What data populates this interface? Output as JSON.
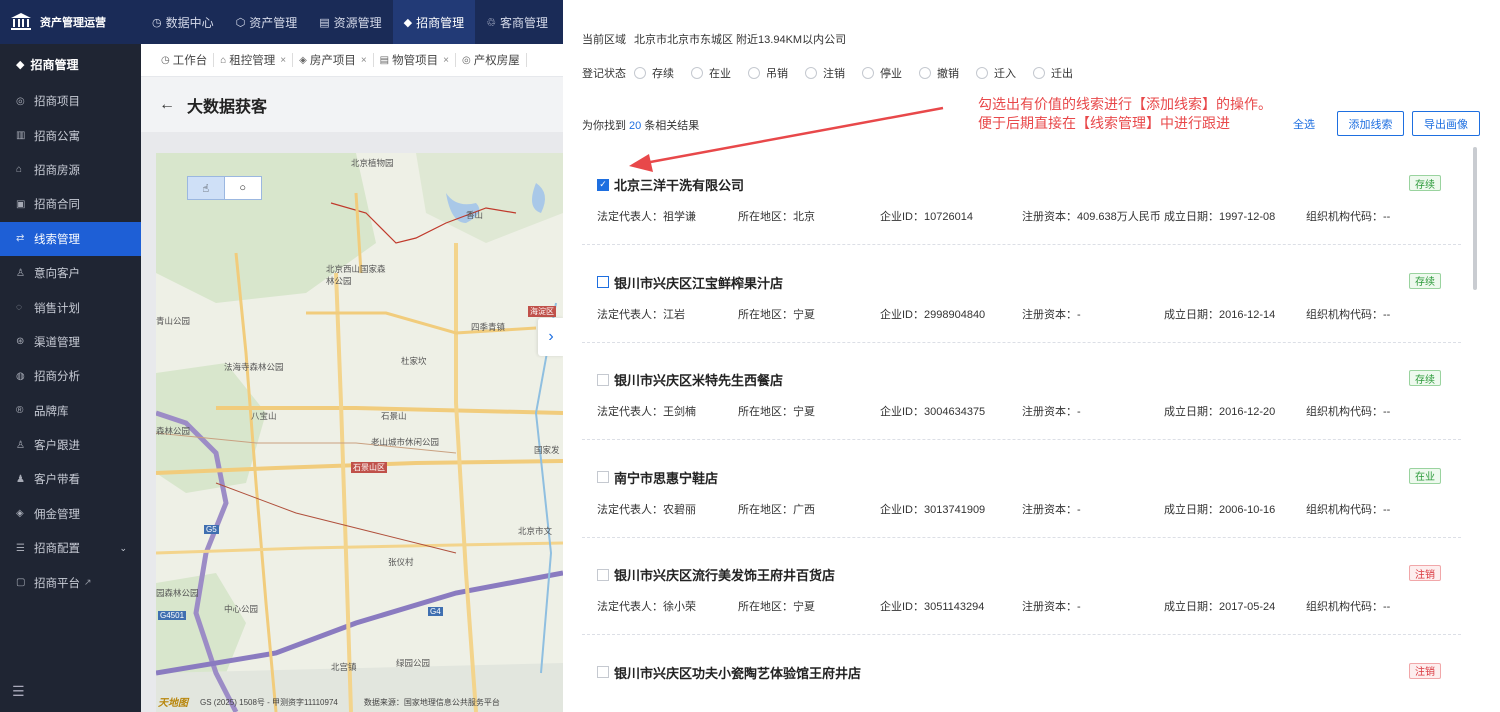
{
  "app": {
    "title": "资产管理运营"
  },
  "topnav": [
    {
      "icon": "◷",
      "label": "数据中心"
    },
    {
      "icon": "⬡",
      "label": "资产管理"
    },
    {
      "icon": "▤",
      "label": "资源管理"
    },
    {
      "icon": "◆",
      "label": "招商管理"
    },
    {
      "icon": "♲",
      "label": "客商管理"
    }
  ],
  "sidebar": {
    "section": "招商管理",
    "items": [
      {
        "icon": "◎",
        "label": "招商项目"
      },
      {
        "icon": "▥",
        "label": "招商公寓"
      },
      {
        "icon": "⌂",
        "label": "招商房源"
      },
      {
        "icon": "▣",
        "label": "招商合同"
      },
      {
        "icon": "⇄",
        "label": "线索管理"
      },
      {
        "icon": "♙",
        "label": "意向客户"
      },
      {
        "icon": "◌",
        "label": "销售计划"
      },
      {
        "icon": "⊛",
        "label": "渠道管理"
      },
      {
        "icon": "◍",
        "label": "招商分析"
      },
      {
        "icon": "®",
        "label": "品牌库"
      },
      {
        "icon": "♙",
        "label": "客户跟进"
      },
      {
        "icon": "♟",
        "label": "客户带看"
      },
      {
        "icon": "◈",
        "label": "佣金管理"
      },
      {
        "icon": "☰",
        "label": "招商配置"
      },
      {
        "icon": "▢",
        "label": "招商平台"
      }
    ]
  },
  "tabs": [
    {
      "icon": "◷",
      "label": "工作台",
      "closable": false
    },
    {
      "icon": "⌂",
      "label": "租控管理",
      "closable": true
    },
    {
      "icon": "◈",
      "label": "房产项目",
      "closable": true
    },
    {
      "icon": "▤",
      "label": "物管项目",
      "closable": true
    },
    {
      "icon": "◎",
      "label": "产权房屋",
      "closable": false
    }
  ],
  "page": {
    "title": "大数据获客",
    "back": "←"
  },
  "map": {
    "labels": {
      "garden": "北京植物园",
      "xiangshan": "香山",
      "xishan": "北京西山国家森林公园",
      "sijiqing": "四季青镇",
      "qingshan": "青山公园",
      "fahaisi": "法海寺森林公园",
      "duzi": "杜家坎",
      "badachu": "八宝山",
      "laoshan": "老山城市休闲公园",
      "shijing": "石景山",
      "shijingshan_road": "石景山区",
      "senlin": "森林公园",
      "guojia": "国家发",
      "hejia": "海淀区",
      "beijingshi": "北京市文",
      "zhangyi": "张仪村",
      "yuanyuan": "园森林公园",
      "zhongxin": "中心公园",
      "lvyuan": "绿园公园",
      "beigong": "北宫镇",
      "g4": "G4",
      "g4501": "G4501",
      "g5": "G5"
    },
    "footer": "GS (2025) 1508号 - 甲测资字11110974",
    "source": "数据来源：国家地理信息公共服务平台",
    "logo": "天地图"
  },
  "panel": {
    "area_label": "当前区域",
    "area_value": "北京市北京市东城区 附近13.94KM以内公司",
    "status_label": "登记状态",
    "status_options": [
      "存续",
      "在业",
      "吊销",
      "注销",
      "停业",
      "撤销",
      "迁入",
      "迁出"
    ],
    "result_prefix": "为你找到",
    "result_count": "20",
    "result_suffix": "条相关结果",
    "annotation_line1": "勾选出有价值的线索进行【添加线索】的操作。",
    "annotation_line2": "便于后期直接在【线索管理】中进行跟进",
    "select_all": "全选",
    "add_lead": "添加线索",
    "export": "导出画像",
    "colors": {
      "accent": "#1e6fe0",
      "annotation": "#e8484a",
      "badge_green": "#2c9a3a",
      "badge_red": "#d9363e"
    }
  },
  "field_labels": {
    "legal": "法定代表人：",
    "region": "所在地区：",
    "id": "企业ID：",
    "capital": "注册资本：",
    "founded": "成立日期：",
    "org": "组织机构代码："
  },
  "companies": [
    {
      "name": "北京三洋干洗有限公司",
      "checked": true,
      "status": "存续",
      "status_color": "green",
      "legal": "祖学谦",
      "region": "北京",
      "id": "10726014",
      "capital": "409.638万人民币",
      "founded": "1997-12-08",
      "org": "--"
    },
    {
      "name": "银川市兴庆区江宝鲜榨果汁店",
      "checked": false,
      "status": "存续",
      "status_color": "green",
      "legal": "江岩",
      "region": "宁夏",
      "id": "2998904840",
      "capital": "-",
      "founded": "2016-12-14",
      "org": "--"
    },
    {
      "name": "银川市兴庆区米特先生西餐店",
      "checked": false,
      "status": "存续",
      "status_color": "green",
      "legal": "王剑楠",
      "region": "宁夏",
      "id": "3004634375",
      "capital": "-",
      "founded": "2016-12-20",
      "org": "--"
    },
    {
      "name": "南宁市思惠宁鞋店",
      "checked": false,
      "status": "在业",
      "status_color": "green",
      "legal": "农碧丽",
      "region": "广西",
      "id": "3013741909",
      "capital": "-",
      "founded": "2006-10-16",
      "org": "--"
    },
    {
      "name": "银川市兴庆区流行美发饰王府井百货店",
      "checked": false,
      "status": "注销",
      "status_color": "red",
      "legal": "徐小荣",
      "region": "宁夏",
      "id": "3051143294",
      "capital": "-",
      "founded": "2017-05-24",
      "org": "--"
    },
    {
      "name": "银川市兴庆区功夫小瓷陶艺体验馆王府井店",
      "checked": false,
      "status": "注销",
      "status_color": "red"
    }
  ]
}
